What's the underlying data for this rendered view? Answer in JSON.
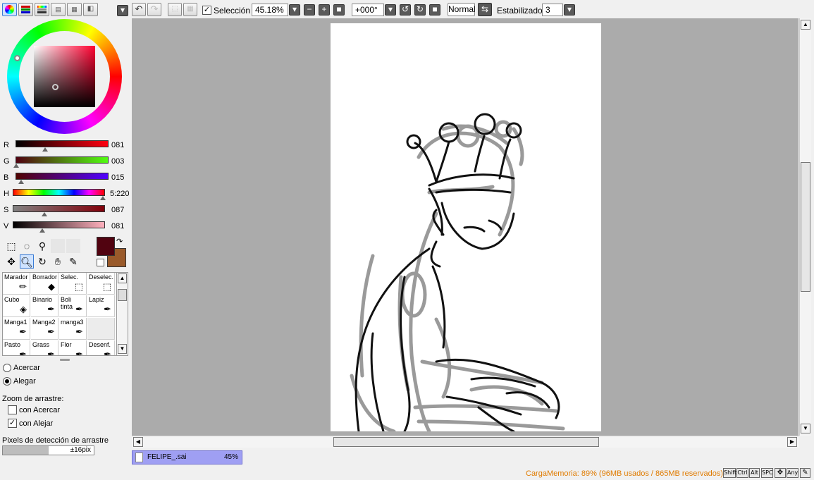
{
  "toolbar": {
    "selection_label": "Selección",
    "selection_checked": true,
    "zoom_value": "45.18%",
    "rotation_value": "+000°",
    "blend_mode": "Normal",
    "stabilizer_label": "Estabilizador",
    "stabilizer_value": "3"
  },
  "color_sliders": [
    {
      "label": "R",
      "value": "081"
    },
    {
      "label": "G",
      "value": "003"
    },
    {
      "label": "B",
      "value": "015"
    },
    {
      "label": "H",
      "value": "5:220"
    },
    {
      "label": "S",
      "value": "087"
    },
    {
      "label": "V",
      "value": "081"
    }
  ],
  "colors": {
    "primary": "#510310",
    "secondary": "#9a5a2a",
    "canvas_bg": "#ababab",
    "status_orange": "#e07b00",
    "file_tab": "#9f9ff3"
  },
  "tools": [
    {
      "label": "Marador",
      "icon": "marker-icon"
    },
    {
      "label": "Borrador",
      "icon": "eraser-icon"
    },
    {
      "label": "Selec.",
      "icon": "select-brush-icon"
    },
    {
      "label": "Deselec.",
      "icon": "deselect-brush-icon"
    },
    {
      "label": "Cubo",
      "icon": "bucket-icon"
    },
    {
      "label": "Binario",
      "icon": "pen-icon"
    },
    {
      "label": "Boli tinta",
      "icon": "pen-icon"
    },
    {
      "label": "Lapiz",
      "icon": "pen-icon"
    },
    {
      "label": "Manga1",
      "icon": "pen-icon"
    },
    {
      "label": "Manga2",
      "icon": "pen-icon"
    },
    {
      "label": "manga3",
      "icon": "pen-icon"
    },
    {
      "label": "",
      "icon": ""
    },
    {
      "label": "Pasto",
      "icon": "pen-icon"
    },
    {
      "label": "Grass",
      "icon": "pen-icon"
    },
    {
      "label": "Flor",
      "icon": "pen-icon"
    },
    {
      "label": "Desenf.",
      "icon": "pen-icon"
    }
  ],
  "zoom_options": {
    "acercar": "Acercar",
    "alegar": "Alegar",
    "drag_zoom_title": "Zoom de arrastre:",
    "con_acercar": "con Acercar",
    "con_alejar": "con Alejar",
    "drag_pixels_label": "Pixels de detección de arrastre",
    "drag_pixels_value": "±16pix",
    "drag_pixels_fraction": 0.5
  },
  "file_tab": {
    "name": "FELIPE_.sai",
    "zoom": "45%"
  },
  "status": {
    "memory": "CargaMemoria: 89% (96MB usados / 865MB reservados)",
    "keys": [
      "Shift",
      "Ctrl",
      "Alt",
      "SPC",
      "Any"
    ]
  }
}
